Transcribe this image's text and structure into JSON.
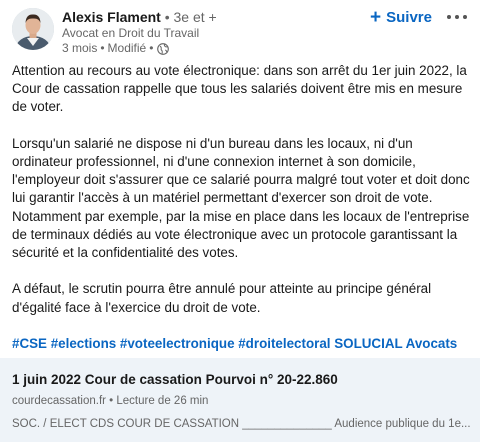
{
  "author": {
    "name": "Alexis Flament",
    "separator": "•",
    "degree": "3e et +",
    "headline": "Avocat en Droit du Travail",
    "time": "3 mois",
    "edited": "Modifié",
    "visibility_icon": "globe-icon"
  },
  "actions": {
    "follow_label": "Suivre",
    "follow_icon": "plus-icon",
    "more_icon": "more-options-icon"
  },
  "post": {
    "paragraphs": [
      "Attention au recours au vote électronique: dans son arrêt du 1er juin 2022, la Cour de cassation rappelle que tous les salariés doivent être mis en mesure de voter.",
      "Lorsqu'un salarié ne dispose ni d'un bureau dans les locaux, ni d'un ordinateur professionnel, ni d'une connexion internet à son domicile, l'employeur doit s'assurer que ce salarié pourra malgré tout voter et doit donc lui garantir l'accès à un matériel permettant d'exercer son droit de vote. Notamment par exemple, par la mise en place dans les locaux de l'entreprise de terminaux dédiés au vote électronique avec un protocole garantissant la sécurité et la confidentialité des votes.",
      "A défaut, le scrutin pourra être annulé pour atteinte au principe général d'égalité face à l'exercice du droit de vote."
    ],
    "hashtags": "#CSE #elections #voteelectronique #droitelectoral SOLUCIAL Avocats"
  },
  "link_card": {
    "title": "1 juin 2022 Cour de cassation Pourvoi n° 20-22.860",
    "source": "courdecassation.fr • Lecture de 26 min",
    "description": "SOC. / ELECT CDS COUR DE CASSATION ______________ Audience publique du 1e..."
  },
  "colors": {
    "accent": "#0a66c2",
    "text": "#191919",
    "muted": "#666666",
    "card_bg": "#eef3f8"
  }
}
